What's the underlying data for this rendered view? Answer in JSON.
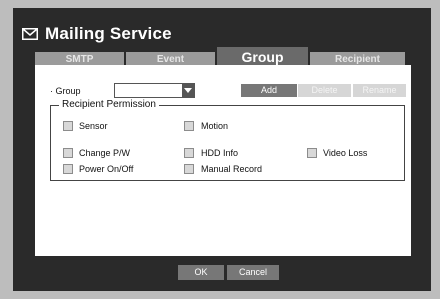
{
  "window": {
    "title": "Mailing Service"
  },
  "tabs": [
    {
      "label": "SMTP",
      "active": false
    },
    {
      "label": "Event",
      "active": false
    },
    {
      "label": "Group",
      "active": true
    },
    {
      "label": "Recipient",
      "active": false
    }
  ],
  "group": {
    "label": "· Group",
    "selected_value": "",
    "add_label": "Add",
    "delete_label": "Delete",
    "rename_label": "Rename"
  },
  "permissions": {
    "legend": "Recipient Permission",
    "items": [
      {
        "label": "Sensor",
        "checked": false
      },
      {
        "label": "Motion",
        "checked": false
      },
      {
        "label": "Change P/W",
        "checked": false
      },
      {
        "label": "HDD Info",
        "checked": false
      },
      {
        "label": "Video Loss",
        "checked": false
      },
      {
        "label": "Power On/Off",
        "checked": false
      },
      {
        "label": "Manual Record",
        "checked": false
      }
    ]
  },
  "footer": {
    "ok_label": "OK",
    "cancel_label": "Cancel"
  }
}
